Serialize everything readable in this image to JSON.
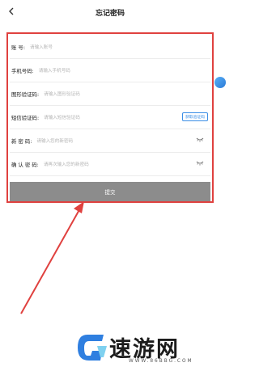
{
  "header": {
    "title": "忘记密码",
    "back_icon": "back-arrow-icon"
  },
  "form": {
    "rows": [
      {
        "label": "账 号:",
        "placeholder": "请输入账号"
      },
      {
        "label": "手机号码:",
        "placeholder": "请输入手机号码"
      },
      {
        "label": "图形验证码:",
        "placeholder": "请输入图形验证码"
      },
      {
        "label": "短信验证码:",
        "placeholder": "请输入短信验证码",
        "button": "获取验证码"
      },
      {
        "label": "新 密 码:",
        "placeholder": "请输入您的新密码",
        "icon": "eye-closed-icon"
      },
      {
        "label": "确 认 密 码:",
        "placeholder": "请再次输入您的新密码",
        "icon": "eye-closed-icon"
      }
    ],
    "submit_label": "提交"
  },
  "watermark": {
    "name": "速游网",
    "url": "WWW.86BBG.COM"
  },
  "colors": {
    "highlight": "#e0413f",
    "accent": "#3a8ee6",
    "submit_bg": "#8c8c8c"
  }
}
